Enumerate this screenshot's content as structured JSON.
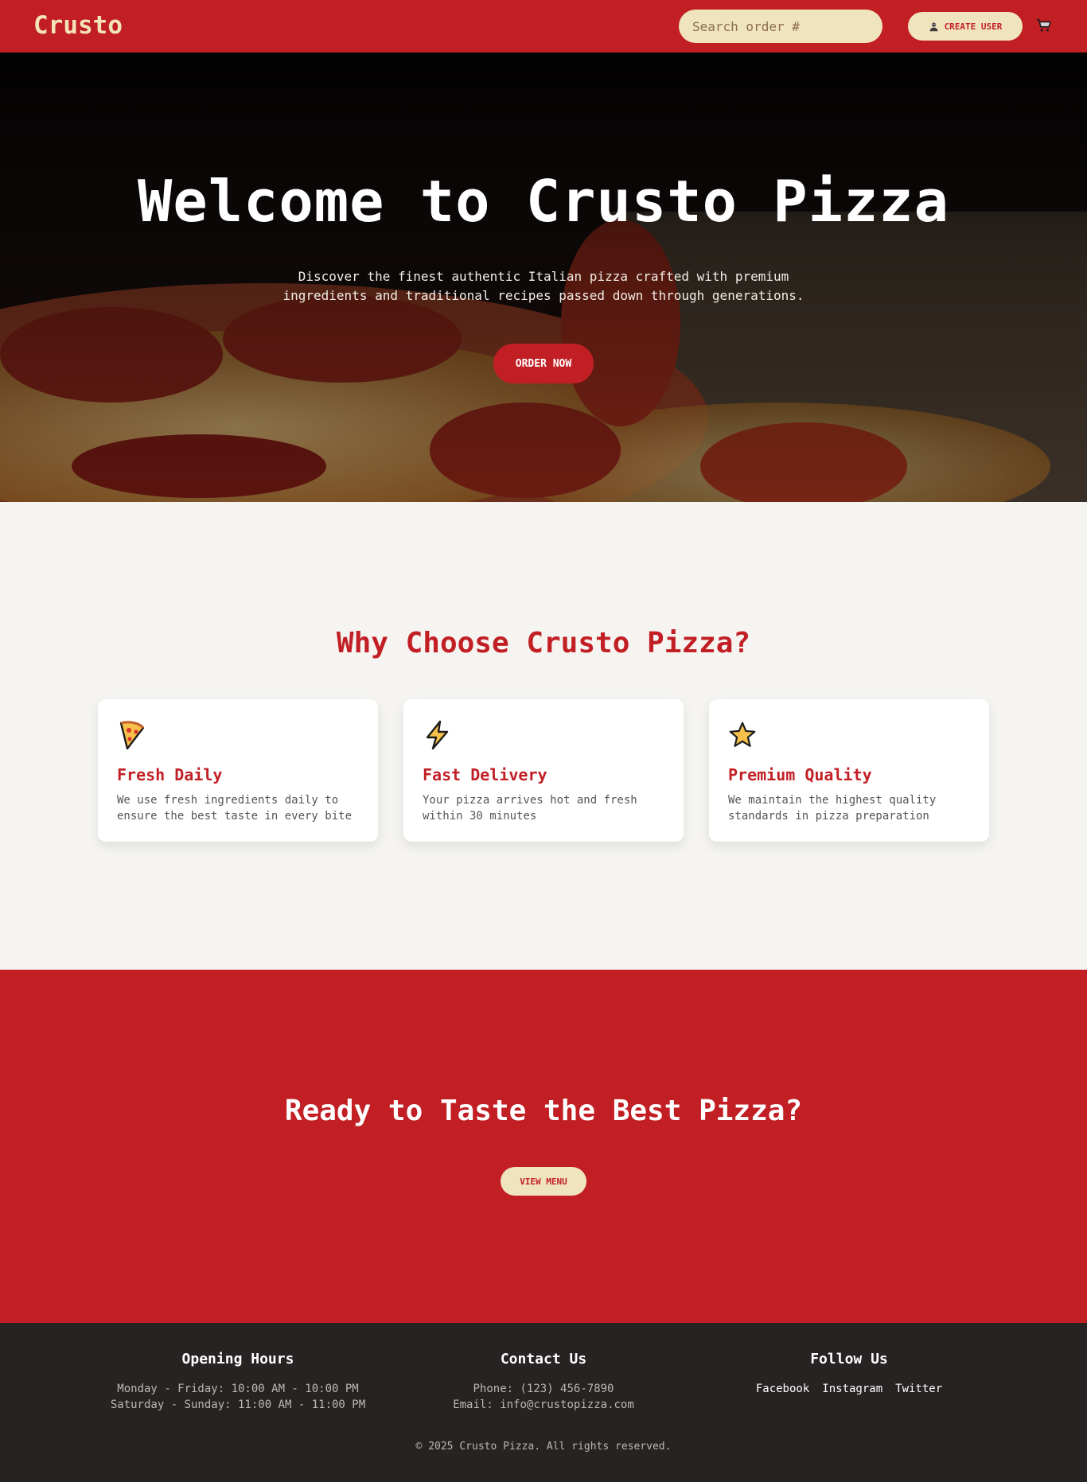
{
  "nav": {
    "logo": "Crusto",
    "search_placeholder": "Search order #",
    "create_user_label": "CREATE USER",
    "user_icon": "user-icon",
    "cart_icon": "cart-icon"
  },
  "hero": {
    "title": "Welcome to Crusto Pizza",
    "subtitle": "Discover the finest authentic Italian pizza crafted with premium ingredients and traditional recipes passed down through generations.",
    "order_button": "ORDER NOW"
  },
  "features": {
    "title": "Why Choose Crusto Pizza?",
    "cards": [
      {
        "icon": "pizza-icon",
        "title": "Fresh Daily",
        "description": "We use fresh ingredients daily to ensure the best taste in every bite"
      },
      {
        "icon": "lightning-icon",
        "title": "Fast Delivery",
        "description": "Your pizza arrives hot and fresh within 30 minutes"
      },
      {
        "icon": "star-icon",
        "title": "Premium Quality",
        "description": "We maintain the highest quality standards in pizza preparation"
      }
    ]
  },
  "cta": {
    "title": "Ready to Taste the Best Pizza?",
    "button": "VIEW MENU"
  },
  "footer": {
    "hours_title": "Opening Hours",
    "hours_weekday": "Monday - Friday: 10:00 AM - 10:00 PM",
    "hours_weekend": "Saturday - Sunday: 11:00 AM - 11:00 PM",
    "contact_title": "Contact Us",
    "phone": "Phone: (123) 456-7890",
    "email": "Email: info@crustopizza.com",
    "follow_title": "Follow Us",
    "social": [
      "Facebook",
      "Instagram",
      "Twitter"
    ],
    "copyright": "© 2025 Crusto Pizza. All rights reserved."
  },
  "colors": {
    "brand_red": "#c21f25",
    "cream": "#f0e4bf",
    "footer_bg": "#262322",
    "page_bg": "#f5f4f1"
  }
}
